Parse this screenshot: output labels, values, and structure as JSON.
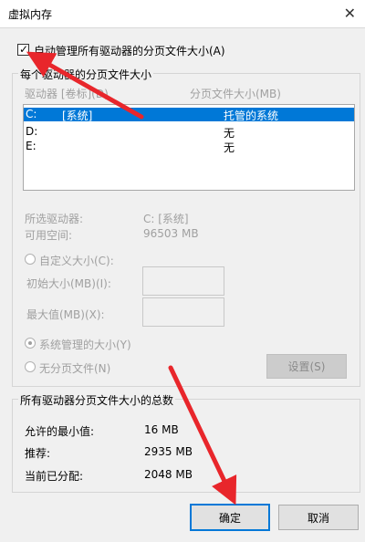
{
  "window": {
    "title": "虚拟内存",
    "close_glyph": "✕"
  },
  "auto_manage": {
    "label": "自动管理所有驱动器的分页文件大小(A)",
    "checked": true,
    "tick": "✓"
  },
  "drives_group": {
    "title": "每个驱动器的分页文件大小",
    "col_drive": "驱动器 [卷标](D)",
    "col_size": "分页文件大小(MB)",
    "rows": [
      {
        "drive": "C:",
        "volume": "[系统]",
        "size": "托管的系统",
        "selected": true
      },
      {
        "drive": "D:",
        "volume": "",
        "size": "无",
        "selected": false
      },
      {
        "drive": "E:",
        "volume": "",
        "size": "无",
        "selected": false
      }
    ],
    "selected_drive_label": "所选驱动器:",
    "selected_drive_value": "C:  [系统]",
    "free_space_label": "可用空间:",
    "free_space_value": "96503 MB",
    "custom_size_label": "自定义大小(C):",
    "initial_size_label": "初始大小(MB)(I):",
    "max_size_label": "最大值(MB)(X):",
    "system_managed_label": "系统管理的大小(Y)",
    "no_paging_label": "无分页文件(N)",
    "set_button": "设置(S)"
  },
  "totals_group": {
    "title": "所有驱动器分页文件大小的总数",
    "min_label": "允许的最小值:",
    "min_value": "16 MB",
    "recommended_label": "推荐:",
    "recommended_value": "2935 MB",
    "current_label": "当前已分配:",
    "current_value": "2048 MB"
  },
  "buttons": {
    "ok": "确定",
    "cancel": "取消"
  },
  "colors": {
    "selection": "#0078d7",
    "arrow": "#e8262b",
    "background": "#f0f0f0"
  }
}
